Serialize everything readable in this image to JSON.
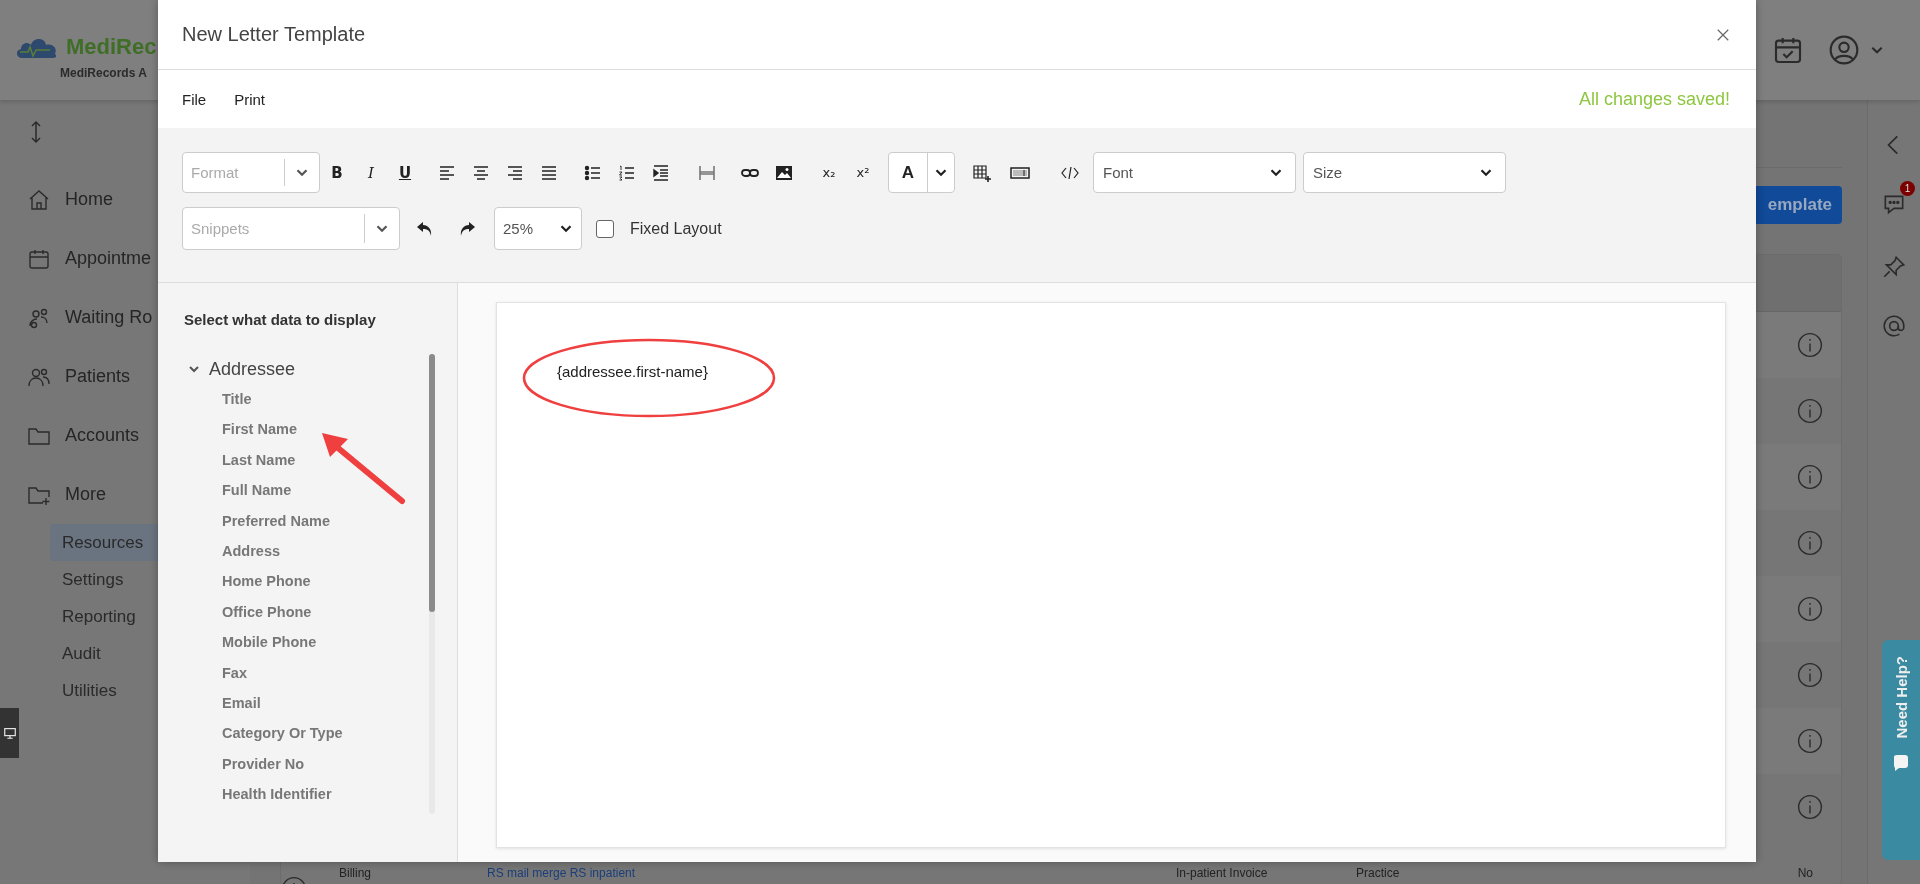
{
  "app": {
    "logo": "MediRec",
    "subtitle": "MediRecords A",
    "nav": [
      {
        "kind": "home",
        "label": "Home"
      },
      {
        "kind": "calendar",
        "label": "Appointme"
      },
      {
        "kind": "waiting",
        "label": "Waiting Ro"
      },
      {
        "kind": "people",
        "label": "Patients"
      },
      {
        "kind": "folder",
        "label": "Accounts"
      },
      {
        "kind": "folder-plus",
        "label": "More"
      }
    ],
    "sub_nav": [
      {
        "label": "Resources",
        "selected": true
      },
      {
        "label": "Settings",
        "selected": false
      },
      {
        "label": "Reporting",
        "selected": false
      },
      {
        "label": "Audit",
        "selected": false
      },
      {
        "label": "Utilities",
        "selected": false
      }
    ],
    "action_button": "emplate",
    "table_row": [
      {
        "kind": "text",
        "text": "Billing"
      },
      {
        "kind": "link",
        "text": "RS mail merge RS inpatient"
      },
      {
        "kind": "text",
        "text": "In-patient Invoice"
      },
      {
        "kind": "text",
        "text": "Practice"
      },
      {
        "kind": "text",
        "text": "No"
      }
    ],
    "chat_badge": "1",
    "help_tab": "Need Help?"
  },
  "dialog": {
    "title": "New Letter Template",
    "menu": [
      "File",
      "Print"
    ],
    "save_status": "All changes saved!",
    "toolbar": {
      "format_placeholder": "Format",
      "buttons": [
        {
          "kind": "bold",
          "label": "B"
        },
        {
          "kind": "italic",
          "label": "I"
        },
        {
          "kind": "underline",
          "label": "U"
        },
        {
          "kind": "align-left"
        },
        {
          "kind": "align-center"
        },
        {
          "kind": "align-right"
        },
        {
          "kind": "justify"
        },
        {
          "kind": "bullet-list"
        },
        {
          "kind": "number-list"
        },
        {
          "kind": "indent"
        },
        {
          "kind": "page-break"
        },
        {
          "kind": "link"
        },
        {
          "kind": "image"
        },
        {
          "kind": "subscript",
          "label": "x₂"
        },
        {
          "kind": "superscript",
          "label": "x²"
        }
      ],
      "color_button": "A",
      "insert_buttons": [
        {
          "kind": "table"
        },
        {
          "kind": "field"
        },
        {
          "kind": "code"
        }
      ],
      "font_placeholder": "Font",
      "size_placeholder": "Size",
      "snippets_placeholder": "Snippets",
      "zoom": "25%",
      "fixed_layout": {
        "label": "Fixed Layout",
        "checked": false
      }
    },
    "data_panel": {
      "heading": "Select what data to display",
      "groups": [
        {
          "label": "Addressee",
          "expanded": true,
          "children": [
            {
              "label": "Title"
            },
            {
              "label": "First Name"
            },
            {
              "label": "Last Name"
            },
            {
              "label": "Full Name"
            },
            {
              "label": "Preferred Name"
            },
            {
              "label": "Address"
            },
            {
              "label": "Home Phone"
            },
            {
              "label": "Office Phone"
            },
            {
              "label": "Mobile Phone"
            },
            {
              "label": "Fax"
            },
            {
              "label": "Email"
            },
            {
              "label": "Category Or Type"
            },
            {
              "label": "Provider No"
            },
            {
              "label": "Health Identifier"
            }
          ]
        }
      ]
    },
    "document": {
      "text": "{addressee.first-name}"
    }
  }
}
